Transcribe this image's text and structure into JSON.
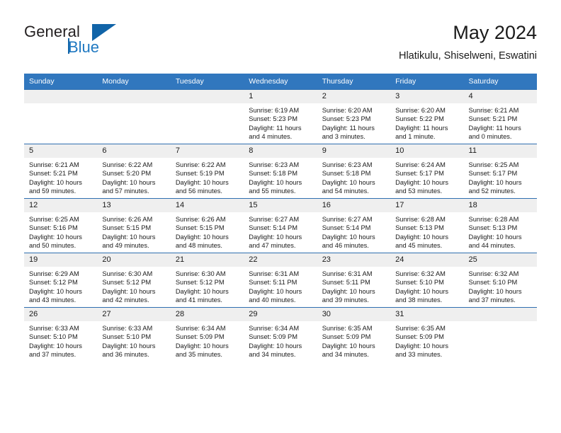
{
  "brand": {
    "name_part1": "General",
    "name_part2": "Blue",
    "logo_icon": "blue-triangle-logo"
  },
  "header": {
    "title": "May 2024",
    "subtitle": "Hlatikulu, Shiselweni, Eswatini"
  },
  "theme": {
    "header_blue": "#3177be",
    "rule_blue": "#2f6fb0",
    "daynum_bg": "#efefef",
    "brand_blue": "#1f78c1",
    "text": "#1a1a1a"
  },
  "weekdays": [
    "Sunday",
    "Monday",
    "Tuesday",
    "Wednesday",
    "Thursday",
    "Friday",
    "Saturday"
  ],
  "labels": {
    "sunrise": "Sunrise:",
    "sunset": "Sunset:",
    "daylight": "Daylight:"
  },
  "weeks": [
    [
      {
        "day": "",
        "empty": true
      },
      {
        "day": "",
        "empty": true
      },
      {
        "day": "",
        "empty": true
      },
      {
        "day": "1",
        "sunrise": "Sunrise: 6:19 AM",
        "sunset": "Sunset: 5:23 PM",
        "daylight": "Daylight: 11 hours and 4 minutes."
      },
      {
        "day": "2",
        "sunrise": "Sunrise: 6:20 AM",
        "sunset": "Sunset: 5:23 PM",
        "daylight": "Daylight: 11 hours and 3 minutes."
      },
      {
        "day": "3",
        "sunrise": "Sunrise: 6:20 AM",
        "sunset": "Sunset: 5:22 PM",
        "daylight": "Daylight: 11 hours and 1 minute."
      },
      {
        "day": "4",
        "sunrise": "Sunrise: 6:21 AM",
        "sunset": "Sunset: 5:21 PM",
        "daylight": "Daylight: 11 hours and 0 minutes."
      }
    ],
    [
      {
        "day": "5",
        "sunrise": "Sunrise: 6:21 AM",
        "sunset": "Sunset: 5:21 PM",
        "daylight": "Daylight: 10 hours and 59 minutes."
      },
      {
        "day": "6",
        "sunrise": "Sunrise: 6:22 AM",
        "sunset": "Sunset: 5:20 PM",
        "daylight": "Daylight: 10 hours and 57 minutes."
      },
      {
        "day": "7",
        "sunrise": "Sunrise: 6:22 AM",
        "sunset": "Sunset: 5:19 PM",
        "daylight": "Daylight: 10 hours and 56 minutes."
      },
      {
        "day": "8",
        "sunrise": "Sunrise: 6:23 AM",
        "sunset": "Sunset: 5:18 PM",
        "daylight": "Daylight: 10 hours and 55 minutes."
      },
      {
        "day": "9",
        "sunrise": "Sunrise: 6:23 AM",
        "sunset": "Sunset: 5:18 PM",
        "daylight": "Daylight: 10 hours and 54 minutes."
      },
      {
        "day": "10",
        "sunrise": "Sunrise: 6:24 AM",
        "sunset": "Sunset: 5:17 PM",
        "daylight": "Daylight: 10 hours and 53 minutes."
      },
      {
        "day": "11",
        "sunrise": "Sunrise: 6:25 AM",
        "sunset": "Sunset: 5:17 PM",
        "daylight": "Daylight: 10 hours and 52 minutes."
      }
    ],
    [
      {
        "day": "12",
        "sunrise": "Sunrise: 6:25 AM",
        "sunset": "Sunset: 5:16 PM",
        "daylight": "Daylight: 10 hours and 50 minutes."
      },
      {
        "day": "13",
        "sunrise": "Sunrise: 6:26 AM",
        "sunset": "Sunset: 5:15 PM",
        "daylight": "Daylight: 10 hours and 49 minutes."
      },
      {
        "day": "14",
        "sunrise": "Sunrise: 6:26 AM",
        "sunset": "Sunset: 5:15 PM",
        "daylight": "Daylight: 10 hours and 48 minutes."
      },
      {
        "day": "15",
        "sunrise": "Sunrise: 6:27 AM",
        "sunset": "Sunset: 5:14 PM",
        "daylight": "Daylight: 10 hours and 47 minutes."
      },
      {
        "day": "16",
        "sunrise": "Sunrise: 6:27 AM",
        "sunset": "Sunset: 5:14 PM",
        "daylight": "Daylight: 10 hours and 46 minutes."
      },
      {
        "day": "17",
        "sunrise": "Sunrise: 6:28 AM",
        "sunset": "Sunset: 5:13 PM",
        "daylight": "Daylight: 10 hours and 45 minutes."
      },
      {
        "day": "18",
        "sunrise": "Sunrise: 6:28 AM",
        "sunset": "Sunset: 5:13 PM",
        "daylight": "Daylight: 10 hours and 44 minutes."
      }
    ],
    [
      {
        "day": "19",
        "sunrise": "Sunrise: 6:29 AM",
        "sunset": "Sunset: 5:12 PM",
        "daylight": "Daylight: 10 hours and 43 minutes."
      },
      {
        "day": "20",
        "sunrise": "Sunrise: 6:30 AM",
        "sunset": "Sunset: 5:12 PM",
        "daylight": "Daylight: 10 hours and 42 minutes."
      },
      {
        "day": "21",
        "sunrise": "Sunrise: 6:30 AM",
        "sunset": "Sunset: 5:12 PM",
        "daylight": "Daylight: 10 hours and 41 minutes."
      },
      {
        "day": "22",
        "sunrise": "Sunrise: 6:31 AM",
        "sunset": "Sunset: 5:11 PM",
        "daylight": "Daylight: 10 hours and 40 minutes."
      },
      {
        "day": "23",
        "sunrise": "Sunrise: 6:31 AM",
        "sunset": "Sunset: 5:11 PM",
        "daylight": "Daylight: 10 hours and 39 minutes."
      },
      {
        "day": "24",
        "sunrise": "Sunrise: 6:32 AM",
        "sunset": "Sunset: 5:10 PM",
        "daylight": "Daylight: 10 hours and 38 minutes."
      },
      {
        "day": "25",
        "sunrise": "Sunrise: 6:32 AM",
        "sunset": "Sunset: 5:10 PM",
        "daylight": "Daylight: 10 hours and 37 minutes."
      }
    ],
    [
      {
        "day": "26",
        "sunrise": "Sunrise: 6:33 AM",
        "sunset": "Sunset: 5:10 PM",
        "daylight": "Daylight: 10 hours and 37 minutes."
      },
      {
        "day": "27",
        "sunrise": "Sunrise: 6:33 AM",
        "sunset": "Sunset: 5:10 PM",
        "daylight": "Daylight: 10 hours and 36 minutes."
      },
      {
        "day": "28",
        "sunrise": "Sunrise: 6:34 AM",
        "sunset": "Sunset: 5:09 PM",
        "daylight": "Daylight: 10 hours and 35 minutes."
      },
      {
        "day": "29",
        "sunrise": "Sunrise: 6:34 AM",
        "sunset": "Sunset: 5:09 PM",
        "daylight": "Daylight: 10 hours and 34 minutes."
      },
      {
        "day": "30",
        "sunrise": "Sunrise: 6:35 AM",
        "sunset": "Sunset: 5:09 PM",
        "daylight": "Daylight: 10 hours and 34 minutes."
      },
      {
        "day": "31",
        "sunrise": "Sunrise: 6:35 AM",
        "sunset": "Sunset: 5:09 PM",
        "daylight": "Daylight: 10 hours and 33 minutes."
      },
      {
        "day": "",
        "empty": true
      }
    ]
  ]
}
